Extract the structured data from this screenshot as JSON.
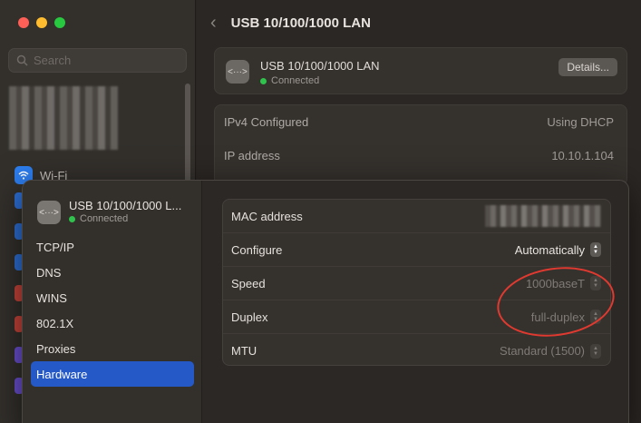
{
  "background": {
    "search_placeholder": "Search",
    "sidebar_wifi_label": "Wi-Fi",
    "header_title": "USB 10/100/1000 LAN",
    "connection": {
      "name": "USB 10/100/1000 LAN",
      "status": "Connected",
      "details_label": "Details..."
    },
    "ip_rows": [
      {
        "key": "IPv4 Configured",
        "value": "Using DHCP"
      },
      {
        "key": "IP address",
        "value": "10.10.1.104"
      }
    ]
  },
  "sheet": {
    "device_name": "USB 10/100/1000 L...",
    "device_status": "Connected",
    "nav": [
      {
        "label": "TCP/IP",
        "active": false
      },
      {
        "label": "DNS",
        "active": false
      },
      {
        "label": "WINS",
        "active": false
      },
      {
        "label": "802.1X",
        "active": false
      },
      {
        "label": "Proxies",
        "active": false
      },
      {
        "label": "Hardware",
        "active": true
      }
    ],
    "hardware": {
      "mac_label": "MAC address",
      "configure_label": "Configure",
      "configure_value": "Automatically",
      "speed_label": "Speed",
      "speed_value": "1000baseT",
      "duplex_label": "Duplex",
      "duplex_value": "full-duplex",
      "mtu_label": "MTU",
      "mtu_value": "Standard (1500)"
    }
  },
  "colors": {
    "accent": "#2459c7",
    "status_green": "#2fc24c",
    "annotation_red": "#e03a30"
  }
}
